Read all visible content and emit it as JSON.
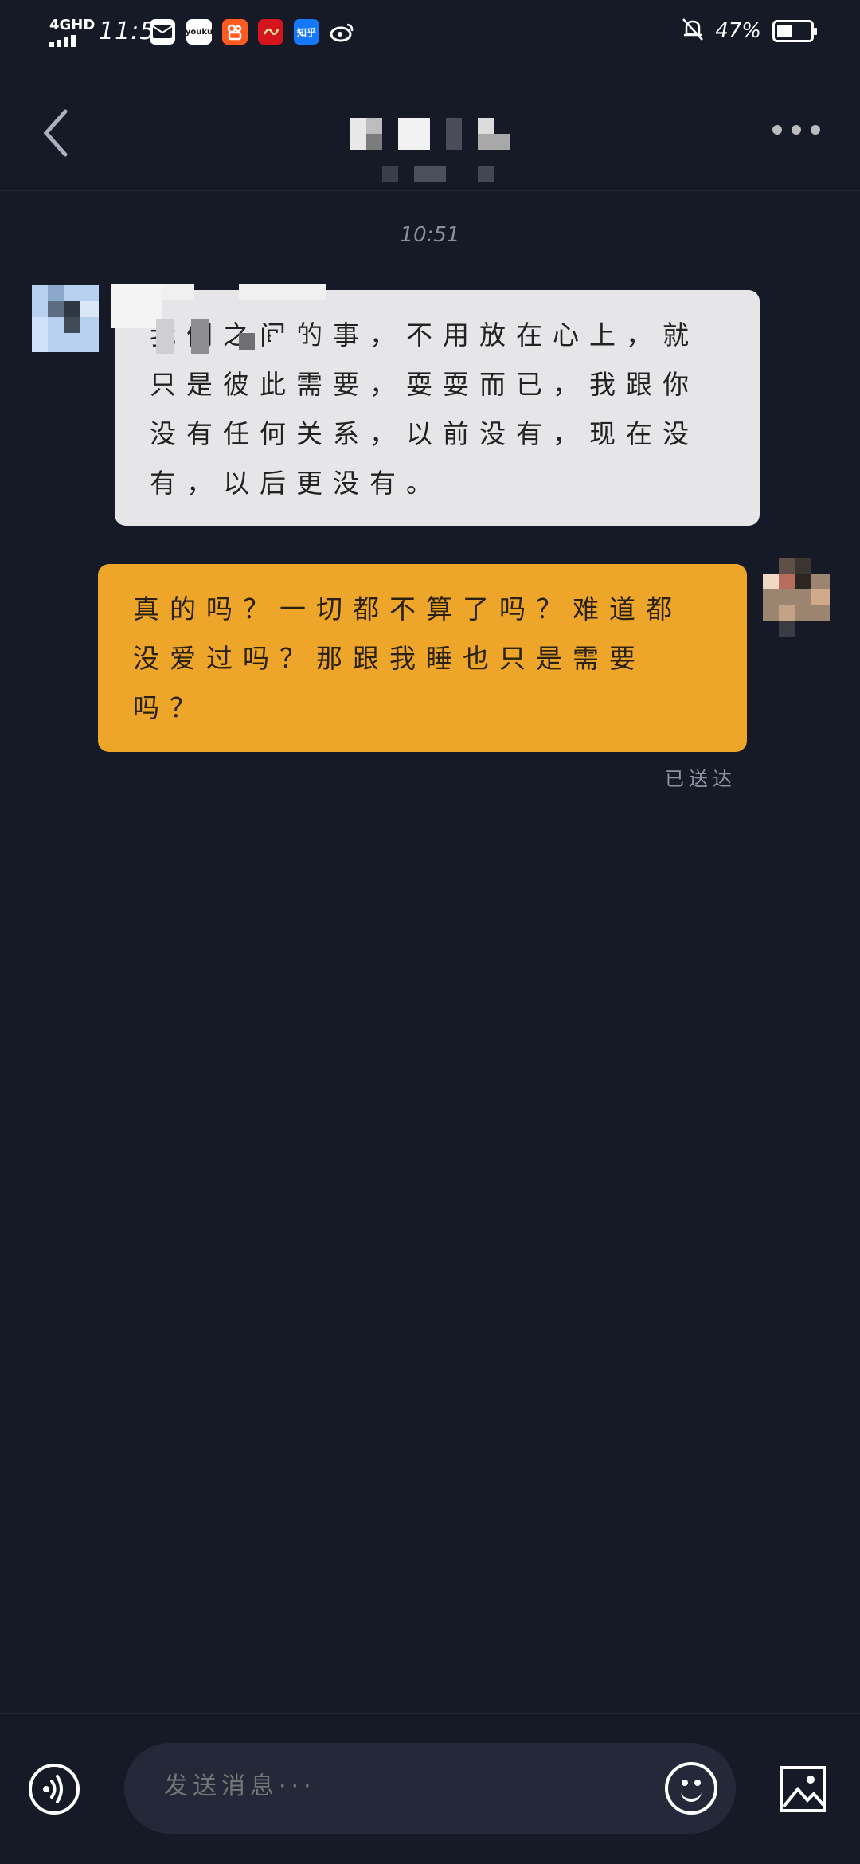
{
  "status_bar": {
    "network": "4GHD",
    "time": "11:52",
    "battery_text": "47%",
    "battery_level": 0.47,
    "app_icons": [
      "mail-icon",
      "youku-icon",
      "kuaishou-icon",
      "app-red-icon",
      "zhihu-icon",
      "weibo-icon"
    ],
    "youku_label": "youku",
    "zhihu_label": "知乎"
  },
  "header": {
    "title_obscured": true
  },
  "chat": {
    "timestamp": "10:51",
    "messages": [
      {
        "side": "left",
        "text": "我们之间的事，不用放在心上，就只是彼此需要，耍耍而已，我跟你没有任何关系，以前没有，现在没有，以后更没有。",
        "bubble_color": "#e6e6e8"
      },
      {
        "side": "right",
        "text": "真的吗？一切都不算了吗？难道都没爱过吗？那跟我睡也只是需要吗？",
        "bubble_color": "#eda62a"
      }
    ],
    "read_receipt": "已送达"
  },
  "input_bar": {
    "placeholder": "发送消息···"
  },
  "colors": {
    "background": "#161a27",
    "accent": "#eda62a"
  }
}
